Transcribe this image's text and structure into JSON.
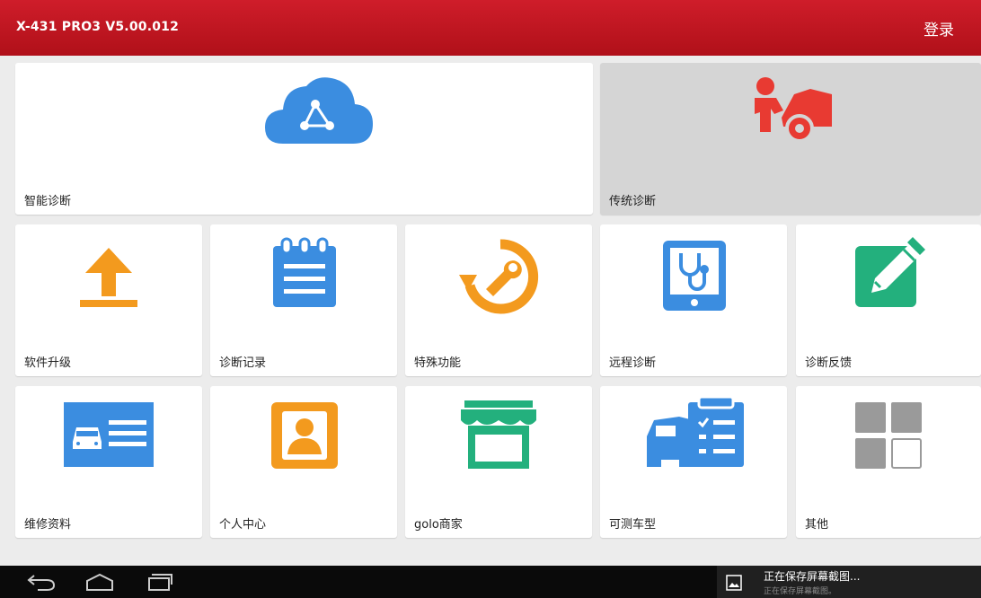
{
  "header": {
    "title": "X-431 PRO3 V5.00.012",
    "login": "登录"
  },
  "tiles": [
    {
      "label": "智能诊断",
      "icon": "cloud-diagnosis-icon",
      "color": "#3b8de0"
    },
    {
      "label": "传统诊断",
      "icon": "mechanic-car-icon",
      "color": "#e83a32"
    },
    {
      "label": "软件升级",
      "icon": "upload-arrow-icon",
      "color": "#f39a1e"
    },
    {
      "label": "诊断记录",
      "icon": "notepad-icon",
      "color": "#3b8de0"
    },
    {
      "label": "特殊功能",
      "icon": "wrench-reset-icon",
      "color": "#f39a1e"
    },
    {
      "label": "远程诊断",
      "icon": "stethoscope-tablet-icon",
      "color": "#3b8de0"
    },
    {
      "label": "诊断反馈",
      "icon": "pencil-edit-icon",
      "color": "#23b07d"
    },
    {
      "label": "维修资料",
      "icon": "car-document-icon",
      "color": "#3b8de0"
    },
    {
      "label": "个人中心",
      "icon": "user-profile-icon",
      "color": "#f39a1e"
    },
    {
      "label": "golo商家",
      "icon": "storefront-icon",
      "color": "#23b07d"
    },
    {
      "label": "可测车型",
      "icon": "car-checklist-icon",
      "color": "#3b8de0"
    },
    {
      "label": "其他",
      "icon": "grid-apps-icon",
      "color": "#9a9a9a"
    }
  ],
  "notification": {
    "title": "正在保存屏幕截图...",
    "subtitle": "正在保存屏幕截图。"
  },
  "navbar": [
    "back-icon",
    "home-icon",
    "recent-apps-icon"
  ]
}
